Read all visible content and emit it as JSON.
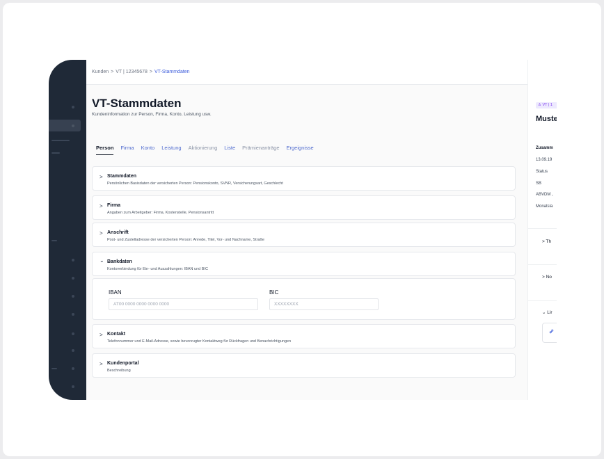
{
  "breadcrumb": {
    "items": [
      "Kunden",
      "VT | 12345678",
      "VT-Stammdaten"
    ],
    "separator": ">"
  },
  "page": {
    "title": "VT-Stammdaten",
    "subtitle": "Kundeninformation zur Person, Firma, Konto, Leistung usw."
  },
  "tabs": [
    {
      "label": "Person"
    },
    {
      "label": "Firma"
    },
    {
      "label": "Konto"
    },
    {
      "label": "Leistung"
    },
    {
      "label": "Aktionierung"
    },
    {
      "label": "Liste"
    },
    {
      "label": "Prämienanträge"
    },
    {
      "label": "Ergeignisse"
    }
  ],
  "sections": [
    {
      "title": "Stammdaten",
      "description": "Persönlichen Basisdaten der versicherten Person: Pensionskonto, SVNR, Versicherungsart, Geschlecht",
      "chevron": ">"
    },
    {
      "title": "Firma",
      "description": "Angaben zum Arbeitgeber: Firma, Kostenstelle, Pensionsantritt",
      "chevron": ">"
    },
    {
      "title": "Anschrift",
      "description": "Post- und Zustelladresse der versicherten Person: Anrede, Titel, Vor- und Nachname, Straße",
      "chevron": ">"
    },
    {
      "title": "Bankdaten",
      "description": "Kontoverbindung für Ein- und Auszahlungen: IBAN und BIC",
      "chevron": "⌄"
    },
    {
      "title": "Kontakt",
      "description": "Telefonnummer und E-Mail-Adresse, sowie bevorzugter Kontaktweg für Rückfragen und Benachrichtigungen",
      "chevron": ">"
    },
    {
      "title": "Kundenportal",
      "description": "Beschreibung",
      "chevron": ">"
    }
  ],
  "bank": {
    "iban_label": "IBAN",
    "iban_placeholder": "AT00 0000 0000 0000 0000",
    "bic_label": "BIC",
    "bic_placeholder": "XXXXXXXX"
  },
  "right_panel": {
    "badge": "♙ VT | 1",
    "name": "Muste",
    "summary_heading": "Zusamm",
    "rows": [
      "13.09.19",
      "Status",
      "SB",
      "ABVDM ,",
      "Monatsla"
    ],
    "accordions": [
      {
        "chevron": ">",
        "label": "Th"
      },
      {
        "chevron": ">",
        "label": "No"
      },
      {
        "chevron": "⌄",
        "label": "Lir"
      }
    ],
    "link_icon": "link-icon"
  },
  "colors": {
    "sidebar": "#1f2937",
    "accent": "#4f6bcf",
    "badge_bg": "#ede9fe",
    "badge_fg": "#7c3aed"
  }
}
